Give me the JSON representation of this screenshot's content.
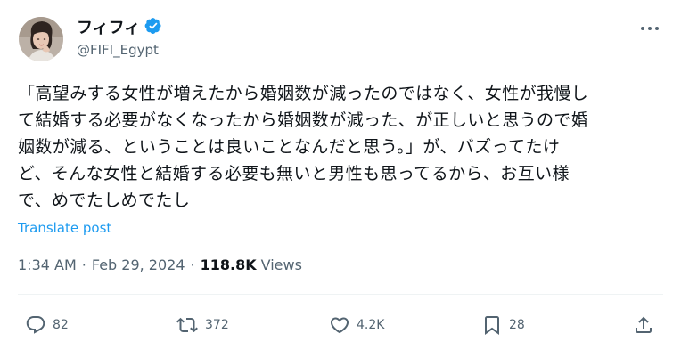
{
  "author": {
    "display_name": "フィフィ",
    "handle": "@FIFI_Egypt",
    "verified_badge_color": "#1d9bf0"
  },
  "header": {
    "more_icon": "more-horizontal-icon"
  },
  "tweet": {
    "text": "「高望みする女性が増えたから婚姻数が減ったのではなく、女性が我慢し\nて結婚する必要がなくなったから婚姻数が減った、が正しいと思うので婚\n姻数が減る、ということは良いことなんだと思う。」が、バズってたけ\nど、そんな女性と結婚する必要も無いと男性も思ってるから、お互い様\nで、めでたしめでたし",
    "translate_label": "Translate post"
  },
  "meta": {
    "time": "1:34 AM",
    "separator": "·",
    "date": "Feb 29, 2024",
    "views_count": "118.8K",
    "views_label": "Views"
  },
  "actions": {
    "replies": "82",
    "reposts": "372",
    "likes": "4.2K",
    "bookmarks": "28"
  },
  "colors": {
    "accent": "#1d9bf0",
    "secondary_text": "#536471",
    "primary_text": "#0f1419",
    "divider": "#eff3f4"
  }
}
